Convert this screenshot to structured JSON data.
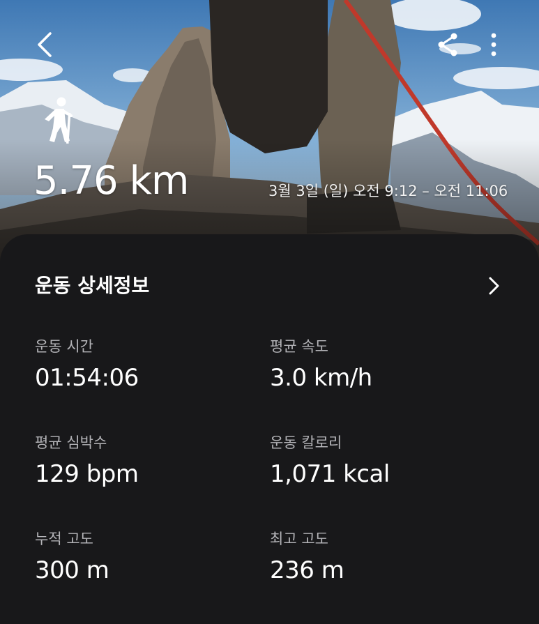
{
  "header": {
    "back_icon": "chevron-left-icon",
    "share_icon": "share-icon",
    "more_icon": "more-vertical-icon"
  },
  "summary": {
    "activity_icon": "hiking-icon",
    "distance": "5.76 km",
    "datetime": "3월 3일 (일) 오전 9:12 – 오전 11:06"
  },
  "details": {
    "title": "운동 상세정보",
    "stats": [
      {
        "label": "운동 시간",
        "value": "01:54:06"
      },
      {
        "label": "평균 속도",
        "value": "3.0 km/h"
      },
      {
        "label": "평균 심박수",
        "value": "129 bpm"
      },
      {
        "label": "운동 칼로리",
        "value": "1,071 kcal"
      },
      {
        "label": "누적 고도",
        "value": "300 m"
      },
      {
        "label": "최고 고도",
        "value": "236 m"
      }
    ]
  },
  "colors": {
    "card_background": "#18181a",
    "label_gray": "#b4b4b8",
    "text_white": "#ffffff",
    "rope_red": "#c0392b"
  }
}
